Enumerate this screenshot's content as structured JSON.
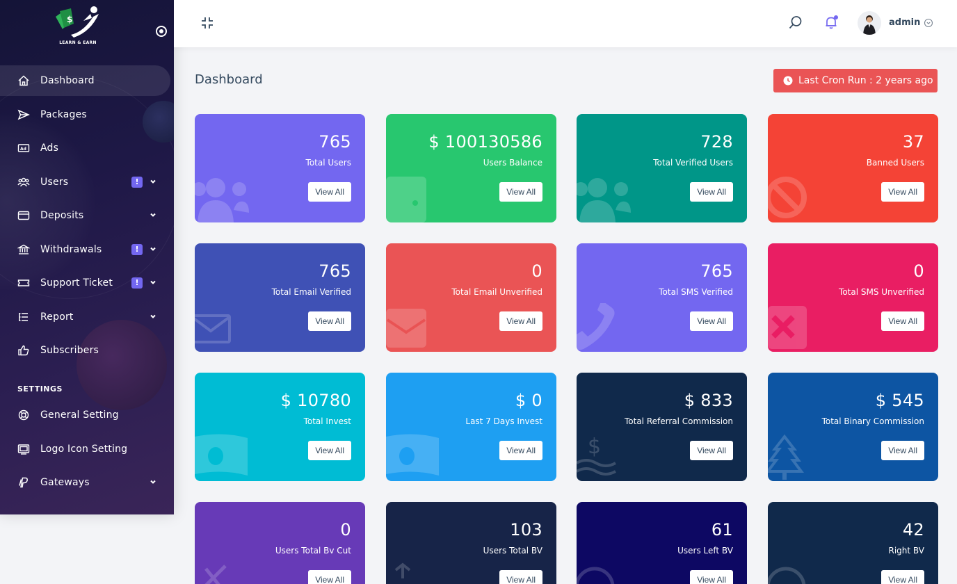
{
  "app": {
    "logo_text": "LEARN & EARN"
  },
  "sidebar": {
    "items": [
      {
        "label": "Dashboard",
        "icon": "home-icon"
      },
      {
        "label": "Packages",
        "icon": "send-icon"
      },
      {
        "label": "Ads",
        "icon": "ad-icon"
      },
      {
        "label": "Users",
        "icon": "users-icon",
        "badge": "!"
      },
      {
        "label": "Deposits",
        "icon": "credit-card-icon"
      },
      {
        "label": "Withdrawals",
        "icon": "bank-icon",
        "badge": "!"
      },
      {
        "label": "Support Ticket",
        "icon": "ticket-icon",
        "badge": "!"
      },
      {
        "label": "Report",
        "icon": "list-icon"
      },
      {
        "label": "Subscribers",
        "icon": "thumbs-up-icon"
      }
    ],
    "settings_label": "SETTINGS",
    "settings_items": [
      {
        "label": "General Setting",
        "icon": "life-ring-icon"
      },
      {
        "label": "Logo Icon Setting",
        "icon": "image-icon"
      },
      {
        "label": "Gateways",
        "icon": "paypal-icon"
      }
    ]
  },
  "topbar": {
    "user_name": "admin"
  },
  "page": {
    "title": "Dashboard",
    "cron_text": "Last Cron Run : 2 years ago"
  },
  "cards": [
    {
      "value": "765",
      "label": "Total Users",
      "button": "View All",
      "color": "#7367f0",
      "icon": "users-icon"
    },
    {
      "value": "$ 100130586",
      "label": "Users Balance",
      "button": "View All",
      "color": "#28c76f",
      "icon": "wallet-icon"
    },
    {
      "value": "728",
      "label": "Total Verified Users",
      "button": "View All",
      "color": "#009688",
      "icon": "users-icon"
    },
    {
      "value": "37",
      "label": "Banned Users",
      "button": "View All",
      "color": "#f44336",
      "icon": "ban-icon"
    },
    {
      "value": "765",
      "label": "Total Email Verified",
      "button": "View All",
      "color": "#3f51b5",
      "icon": "envelope-icon"
    },
    {
      "value": "0",
      "label": "Total Email Unverified",
      "button": "View All",
      "color": "#ea5455",
      "icon": "envelope-open-icon"
    },
    {
      "value": "765",
      "label": "Total SMS Verified",
      "button": "View All",
      "color": "#7367f0",
      "icon": "phone-icon"
    },
    {
      "value": "0",
      "label": "Total SMS Unverified",
      "button": "View All",
      "color": "#e91e63",
      "icon": "times-square-icon"
    },
    {
      "value": "$ 10780",
      "label": "Total Invest",
      "button": "View All",
      "color": "#00bcd4",
      "icon": "money-icon"
    },
    {
      "value": "$ 0",
      "label": "Last 7 Days Invest",
      "button": "View All",
      "color": "#1e9ff2",
      "icon": "money-icon"
    },
    {
      "value": "$ 833",
      "label": "Total Referral Commission",
      "button": "View All",
      "color": "#10294b",
      "icon": "dollar-hand-icon"
    },
    {
      "value": "$ 545",
      "label": "Total Binary Commission",
      "button": "View All",
      "color": "#0d55a3",
      "icon": "tree-icon"
    },
    {
      "value": "0",
      "label": "Users Total Bv Cut",
      "button": "View All",
      "color": "#673ab7",
      "icon": "cut-icon"
    },
    {
      "value": "103",
      "label": "Users Total BV",
      "button": "View All",
      "color": "#172448",
      "icon": "arrow-icon"
    },
    {
      "value": "61",
      "label": "Users Left BV",
      "button": "View All",
      "color": "#0d0863",
      "icon": "arrow-left-icon"
    },
    {
      "value": "42",
      "label": "Right BV",
      "button": "View All",
      "color": "#10294b",
      "icon": "arrow-right-icon"
    }
  ]
}
